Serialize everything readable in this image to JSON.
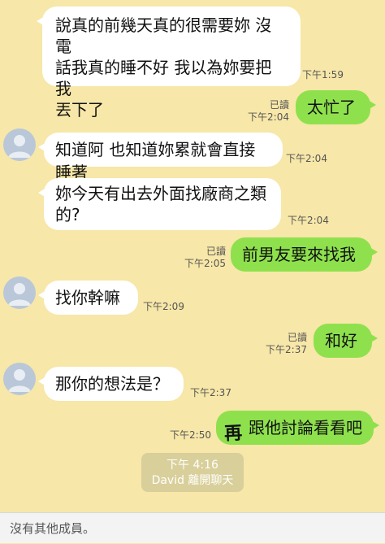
{
  "messages": [
    {
      "side": "in",
      "text": "說真的前幾天真的很需要妳 沒電\n話我真的睡不好 我以為妳要把我\n丟下了",
      "time": "下午1:59"
    },
    {
      "side": "out",
      "text": "太忙了",
      "read": "已讀",
      "time": "下午2:04"
    },
    {
      "side": "in",
      "text": "知道阿 也知道妳累就會直接睡著",
      "time": "下午2:04"
    },
    {
      "side": "in",
      "text": "妳今天有出去外面找廠商之類\n的?",
      "time": "下午2:04"
    },
    {
      "side": "out",
      "text": "前男友要來找我",
      "read": "已讀",
      "time": "下午2:05"
    },
    {
      "side": "in",
      "text": "找你幹嘛",
      "time": "下午2:09"
    },
    {
      "side": "out",
      "text": "和好",
      "read": "已讀",
      "time": "下午2:37"
    },
    {
      "side": "in",
      "text": "那你的想法是？",
      "time": "下午2:37"
    },
    {
      "side": "out",
      "text": "跟他討論看看吧",
      "time": "下午2:50",
      "sticker": "再"
    }
  ],
  "system": {
    "time": "下午 4:16",
    "text": "David 離開聊天"
  },
  "footer": {
    "text": "沒有其他成員。"
  },
  "colors": {
    "background": "#f7e7a8",
    "outgoing": "#8ee14d",
    "incoming": "#ffffff"
  }
}
